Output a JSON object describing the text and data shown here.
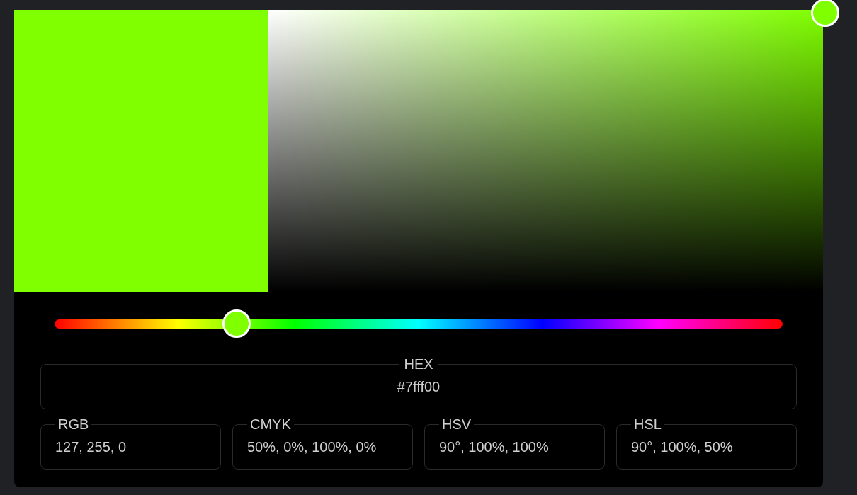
{
  "preview": {
    "color": "#7fff00"
  },
  "hue_slider": {
    "level": 0.25
  },
  "hex": {
    "label": "HEX",
    "value": "#7fff00"
  },
  "formats": [
    {
      "label": "RGB",
      "value": "127, 255, 0"
    },
    {
      "label": "CMYK",
      "value": "50%, 0%, 100%, 0%"
    },
    {
      "label": "HSV",
      "value": "90°, 100%, 100%"
    },
    {
      "label": "HSL",
      "value": "90°, 100%, 50%"
    }
  ]
}
